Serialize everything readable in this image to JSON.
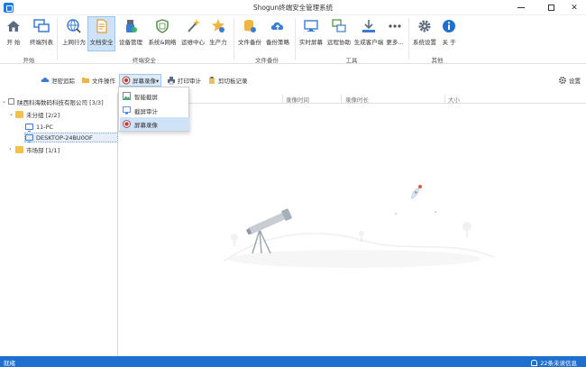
{
  "window": {
    "title": "Shogun终端安全管理系统"
  },
  "ribbon": {
    "items": [
      {
        "label": "开 始",
        "icon": "home-icon"
      },
      {
        "label": "终端列表",
        "icon": "monitors-icon"
      },
      {
        "label": "上网行为",
        "icon": "globe-search-icon"
      },
      {
        "label": "文档安全",
        "icon": "document-lock-icon"
      },
      {
        "label": "设备管理",
        "icon": "usb-device-icon"
      },
      {
        "label": "系统&网络",
        "icon": "shield-icon"
      },
      {
        "label": "运维中心",
        "icon": "magic-wand-icon"
      },
      {
        "label": "生产力",
        "icon": "star-person-icon"
      },
      {
        "label": "文件备份",
        "icon": "database-icon"
      },
      {
        "label": "备份策略",
        "icon": "cloud-upload-icon"
      },
      {
        "label": "实时屏幕",
        "icon": "screen-icon"
      },
      {
        "label": "远程协助",
        "icon": "remote-icon"
      },
      {
        "label": "生成客户端",
        "icon": "download-icon"
      },
      {
        "label": "更多...",
        "icon": "more-icon"
      },
      {
        "label": "系统设置",
        "icon": "gear-icon"
      },
      {
        "label": "关 于",
        "icon": "info-icon"
      }
    ],
    "groups": [
      {
        "label": "开始"
      },
      {
        "label": "终端安全"
      },
      {
        "label": "文件备份"
      },
      {
        "label": "工具"
      },
      {
        "label": "其他"
      }
    ]
  },
  "toolbar": {
    "items": [
      {
        "label": "泄密追踪"
      },
      {
        "label": "文件操作"
      },
      {
        "label": "屏幕录像▾"
      },
      {
        "label": "打印审计"
      },
      {
        "label": "剪切板记录"
      }
    ],
    "settings_label": "设置"
  },
  "menu": {
    "items": [
      {
        "label": "智能截屏"
      },
      {
        "label": "截屏审计"
      },
      {
        "label": "屏幕录像"
      }
    ]
  },
  "tree": {
    "root": "陕西科海数码科技有限公司 [3/3]",
    "group1": "未分组 [2/2]",
    "pc1": "11-PC",
    "pc2": "DESKTOP-24BU0OF",
    "group2": "市场部 [1/1]"
  },
  "table": {
    "columns": [
      "录像时间",
      "录像时长",
      "大小"
    ]
  },
  "status": {
    "left": "就绪",
    "right": "22条未读信息"
  },
  "colors": {
    "accent": "#1e6fd0",
    "selected_bg": "#cde3f7"
  }
}
